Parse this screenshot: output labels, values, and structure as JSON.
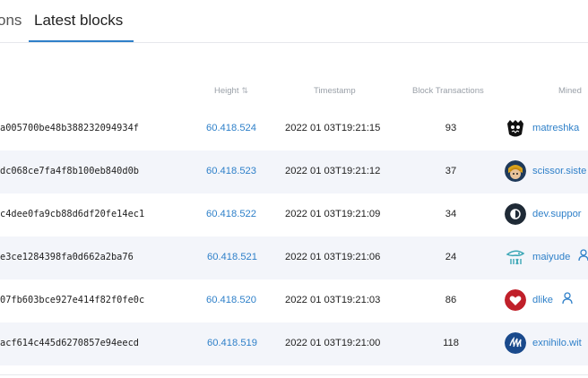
{
  "tabs": {
    "previous_label": "ons",
    "active_label": "Latest blocks"
  },
  "table": {
    "headers": {
      "height": "Height",
      "timestamp": "Timestamp",
      "transactions": "Block Transactions",
      "miner": "Mined"
    },
    "rows": [
      {
        "hash": "a005700be48b388232094934f",
        "height": "60.418.524",
        "timestamp": "2022 01 03T19:21:15",
        "transactions": "93",
        "miner": "matreshka",
        "avatar": "matreshka-avatar-icon",
        "verified": false
      },
      {
        "hash": "dc068ce7fa4f8b100eb840d0b",
        "height": "60.418.523",
        "timestamp": "2022 01 03T19:21:12",
        "transactions": "37",
        "miner": "scissor.siste",
        "avatar": "scissor-avatar-icon",
        "verified": false
      },
      {
        "hash": "c4dee0fa9cb88d6df20fe14ec1",
        "height": "60.418.522",
        "timestamp": "2022 01 03T19:21:09",
        "transactions": "34",
        "miner": "dev.suppor",
        "avatar": "dev-support-avatar-icon",
        "verified": false
      },
      {
        "hash": "e3ce1284398fa0d662a2ba76",
        "height": "60.418.521",
        "timestamp": "2022 01 03T19:21:06",
        "transactions": "24",
        "miner": "maiyude",
        "avatar": "maiyude-avatar-icon",
        "verified": true
      },
      {
        "hash": "07fb603bce927e414f82f0fe0c",
        "height": "60.418.520",
        "timestamp": "2022 01 03T19:21:03",
        "transactions": "86",
        "miner": "dlike",
        "avatar": "dlike-heart-avatar-icon",
        "verified": true
      },
      {
        "hash": "acf614c445d6270857e94eecd",
        "height": "60.418.519",
        "timestamp": "2022 01 03T19:21:00",
        "transactions": "118",
        "miner": "exnihilo.wit",
        "avatar": "steem-avatar-icon",
        "verified": false
      }
    ]
  },
  "colors": {
    "accent": "#2f80c9",
    "alt_row": "#f3f5fa",
    "header_text": "#9aa0a8"
  }
}
